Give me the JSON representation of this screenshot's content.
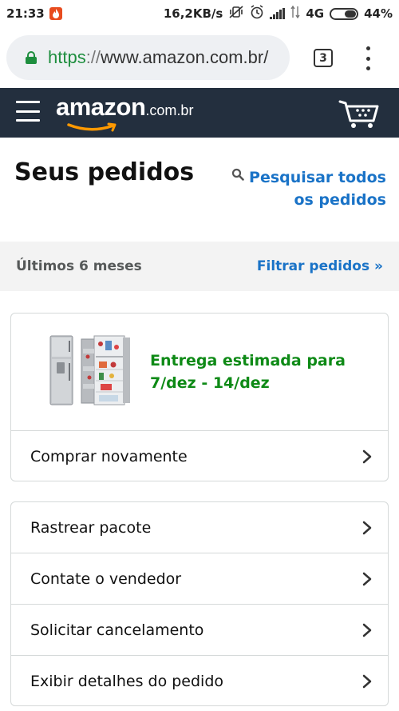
{
  "status_bar": {
    "time": "21:33",
    "network_speed": "16,2KB/s",
    "network_type": "4G",
    "battery": "44%"
  },
  "browser": {
    "url_scheme": "https",
    "url_separator": "://",
    "url_host": "www.amazon.com.br/",
    "tab_count": "3"
  },
  "header": {
    "logo_word": "amazon",
    "logo_suffix": ".com.br",
    "background_color": "#232f3e"
  },
  "page": {
    "title": "Seus pedidos",
    "search_link": "Pesquisar todos os pedidos"
  },
  "filter": {
    "period_label": "Últimos 6 meses",
    "filter_link": "Filtrar pedidos »"
  },
  "order": {
    "delivery_line1": "Entrega estimada para",
    "delivery_line2": "7/dez - 14/dez",
    "buy_again": "Comprar novamente"
  },
  "actions": [
    {
      "label": "Rastrear pacote"
    },
    {
      "label": "Contate o vendedor"
    },
    {
      "label": "Solicitar cancelamento"
    },
    {
      "label": "Exibir detalhes do pedido"
    }
  ],
  "colors": {
    "link": "#1a73c7",
    "delivery_green": "#0e8a16",
    "secure_green": "#1e8e3e"
  }
}
